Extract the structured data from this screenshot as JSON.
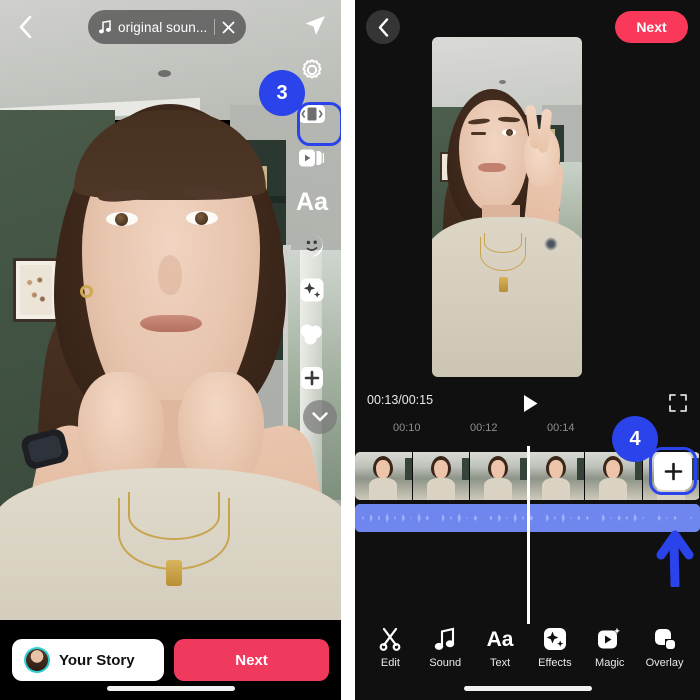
{
  "left_panel": {
    "top_bar": {
      "back_icon": "chevron-left-icon",
      "sound_pill": {
        "music_icon": "music-note-icon",
        "label": "original soun...",
        "close_icon": "close-icon"
      },
      "send_icon": "send-icon"
    },
    "rail": {
      "items": [
        {
          "name": "settings",
          "icon": "gear-icon"
        },
        {
          "name": "layout",
          "icon": "layout-icon",
          "highlighted": true
        },
        {
          "name": "templates",
          "icon": "cards-play-icon"
        },
        {
          "name": "text",
          "icon": "text-aa-icon",
          "label": "Aa"
        },
        {
          "name": "stickers",
          "icon": "sticker-face-icon"
        },
        {
          "name": "effects",
          "icon": "sparkle-icon"
        },
        {
          "name": "filters",
          "icon": "filters-circles-icon"
        },
        {
          "name": "add",
          "icon": "plus-icon"
        }
      ],
      "collapse_icon": "chevron-down-icon"
    },
    "annotation": {
      "step_number": "3",
      "color": "#2a43ea"
    },
    "bottom": {
      "story_button_label": "Your Story",
      "avatar_icon": "avatar",
      "next_button_label": "Next"
    }
  },
  "right_panel": {
    "top_bar": {
      "back_icon": "chevron-left-icon",
      "next_button_label": "Next"
    },
    "transport": {
      "current_time": "00:13",
      "separator": "/",
      "total_time": "00:15",
      "time_readout": "00:13/00:15",
      "play_icon": "play-icon",
      "fullscreen_icon": "fullscreen-icon"
    },
    "ruler": {
      "ticks": [
        "00:10",
        "00:12",
        "00:14"
      ]
    },
    "timeline": {
      "frame_count": 6,
      "waveform_color": "#9db0fa",
      "playhead_color": "#ffffff",
      "add_clip_icon": "plus-icon"
    },
    "annotation": {
      "step_number": "4",
      "color": "#2a43ea",
      "arrow_icon": "arrow-up-icon"
    },
    "toolbar": [
      {
        "label": "Edit",
        "icon": "scissors-icon"
      },
      {
        "label": "Sound",
        "icon": "music-note-icon"
      },
      {
        "label": "Text",
        "icon": "text-aa-icon",
        "glyph": "Aa"
      },
      {
        "label": "Effects",
        "icon": "sparkle-square-icon"
      },
      {
        "label": "Magic",
        "icon": "magic-play-icon"
      },
      {
        "label": "Overlay",
        "icon": "overlay-squares-icon"
      }
    ]
  },
  "colors": {
    "annotation_blue": "#2a43ea",
    "instagram_pink": "#ef3a5d",
    "tiktok_red": "#f9385a",
    "waveform": "#9db0fa"
  }
}
